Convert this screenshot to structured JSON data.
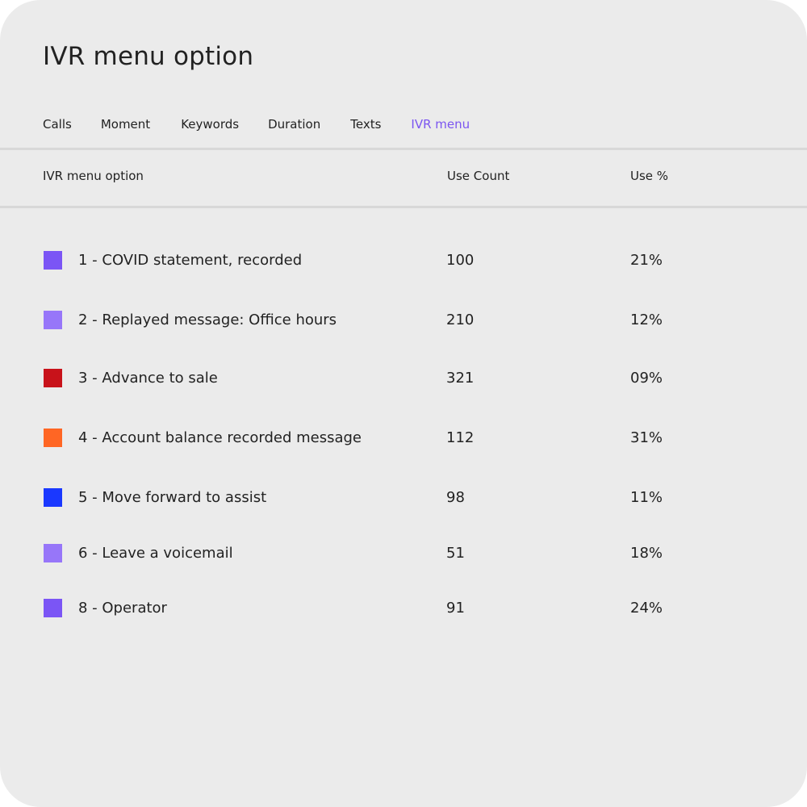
{
  "page": {
    "title": "IVR menu option"
  },
  "tabs": [
    {
      "label": "Calls",
      "active": false
    },
    {
      "label": "Moment",
      "active": false
    },
    {
      "label": "Keywords",
      "active": false
    },
    {
      "label": "Duration",
      "active": false
    },
    {
      "label": "Texts",
      "active": false
    },
    {
      "label": "IVR menu",
      "active": true
    }
  ],
  "colors": {
    "accent": "#7b55f0",
    "background": "#ebebeb",
    "divider": "#d8d8d8",
    "text": "#222222"
  },
  "table": {
    "headers": {
      "option": "IVR menu option",
      "count": "Use Count",
      "percent": "Use %"
    },
    "rows": [
      {
        "label": "1 - COVID statement, recorded",
        "count": "100",
        "percent": "21%",
        "color": "#7b55f5"
      },
      {
        "label": "2 - Replayed message: Office hours",
        "count": "210",
        "percent": "12%",
        "color": "#9776f9"
      },
      {
        "label": "3 - Advance to sale",
        "count": "321",
        "percent": "09%",
        "color": "#c8121a"
      },
      {
        "label": "4 - Account balance recorded message",
        "count": "112",
        "percent": "31%",
        "color": "#ff6624"
      },
      {
        "label": "5 - Move forward to assist",
        "count": "98",
        "percent": "11%",
        "color": "#1a38ff"
      },
      {
        "label": "6 - Leave a voicemail",
        "count": "51",
        "percent": "18%",
        "color": "#9776f9"
      },
      {
        "label": "8 - Operator",
        "count": "91",
        "percent": "24%",
        "color": "#7b55f5"
      }
    ]
  }
}
